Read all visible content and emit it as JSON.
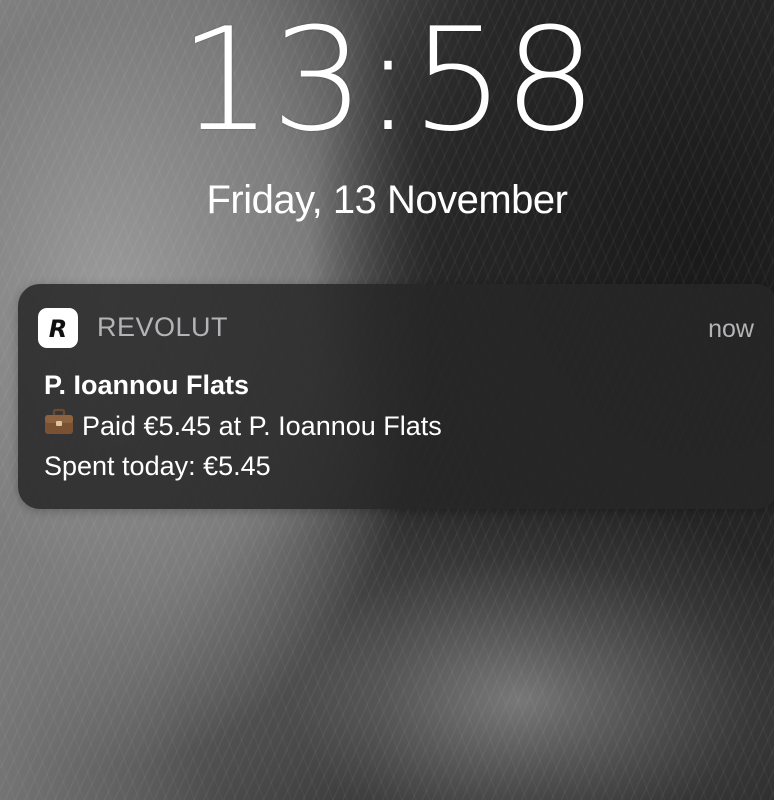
{
  "lockscreen": {
    "time": "13:58",
    "date": "Friday, 13 November"
  },
  "notification": {
    "app_icon": "revolut-r-icon",
    "app_name": "REVOLUT",
    "time": "now",
    "title": "P. Ioannou Flats",
    "body_icon": "briefcase-icon",
    "line1": "Paid €5.45 at P. Ioannou Flats",
    "line2": "Spent today: €5.45"
  },
  "colors": {
    "notification_background": "#262628",
    "secondary_text": "#b4b4b6",
    "primary_text": "#ffffff"
  }
}
